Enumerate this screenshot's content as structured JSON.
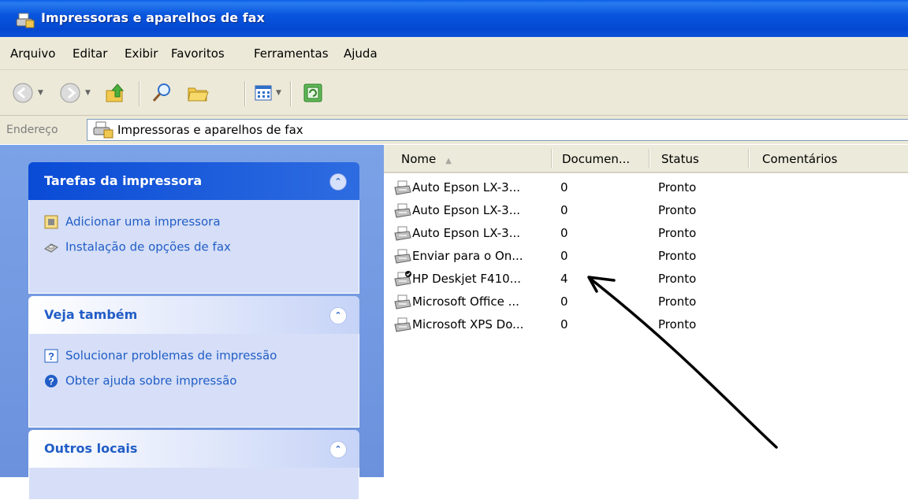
{
  "window": {
    "title": "Impressoras e aparelhos de fax"
  },
  "menu": [
    "Arquivo",
    "Editar",
    "Exibir",
    "Favoritos",
    "Ferramentas",
    "Ajuda"
  ],
  "address": {
    "label": "Endereço",
    "value": "Impressoras e aparelhos de fax"
  },
  "taskpane": {
    "printer_tasks": {
      "title": "Tarefas da impressora",
      "items": [
        "Adicionar uma impressora",
        "Instalação de opções de fax"
      ]
    },
    "see_also": {
      "title": "Veja também",
      "items": [
        "Solucionar problemas de impressão",
        "Obter ajuda sobre impressão"
      ]
    },
    "other_places": {
      "title": "Outros locais"
    }
  },
  "list": {
    "columns": [
      "Nome",
      "Documen...",
      "Status",
      "Comentários"
    ],
    "rows": [
      {
        "name": "Auto Epson LX-3...",
        "documents": "0",
        "status": "Pronto"
      },
      {
        "name": "Auto Epson LX-3...",
        "documents": "0",
        "status": "Pronto"
      },
      {
        "name": "Auto Epson LX-3...",
        "documents": "0",
        "status": "Pronto"
      },
      {
        "name": "Enviar para o On...",
        "documents": "0",
        "status": "Pronto"
      },
      {
        "name": "HP Deskjet F410...",
        "documents": "4",
        "status": "Pronto"
      },
      {
        "name": "Microsoft Office ...",
        "documents": "0",
        "status": "Pronto"
      },
      {
        "name": "Microsoft XPS Do...",
        "documents": "0",
        "status": "Pronto"
      }
    ]
  },
  "colors": {
    "titlebar": "#0855dd",
    "taskpane": "#7ba2e7",
    "link": "#215dc6",
    "panel_body": "#d6dff7"
  }
}
